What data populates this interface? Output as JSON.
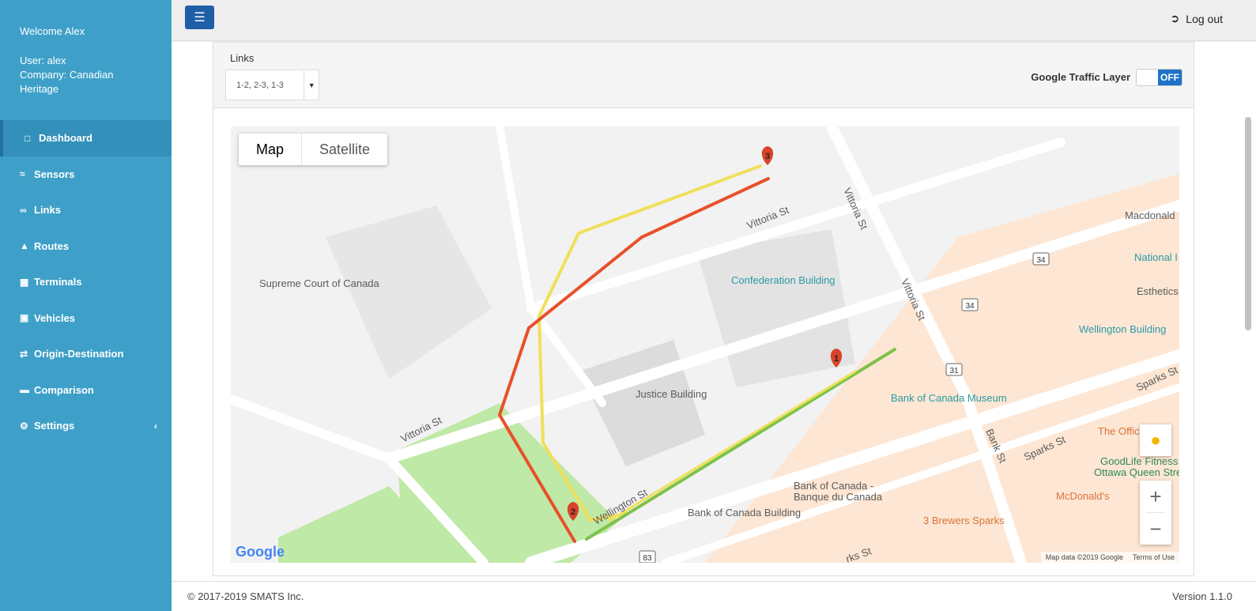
{
  "sidebar": {
    "welcome": "Welcome Alex",
    "user": "User: alex",
    "company": "Company: Canadian Heritage",
    "items": [
      {
        "label": "Dashboard",
        "icon": "map-icon"
      },
      {
        "label": "Sensors",
        "icon": "wifi-icon"
      },
      {
        "label": "Links",
        "icon": "link-icon"
      },
      {
        "label": "Routes",
        "icon": "road-icon"
      },
      {
        "label": "Terminals",
        "icon": "grid-icon"
      },
      {
        "label": "Vehicles",
        "icon": "bus-icon"
      },
      {
        "label": "Origin-Destination",
        "icon": "shuffle-icon"
      },
      {
        "label": "Comparison",
        "icon": "hdd-icon"
      },
      {
        "label": "Settings",
        "icon": "gear-icon"
      }
    ]
  },
  "header": {
    "logout": "Log out"
  },
  "filters": {
    "links_label": "Links",
    "links_value": "1-2, 2-3, 1-3",
    "traffic_label": "Google Traffic Layer",
    "traffic_state": "OFF"
  },
  "map": {
    "type_map": "Map",
    "type_satellite": "Satellite",
    "markers": [
      "1",
      "2",
      "3"
    ],
    "labels": {
      "supreme_court": "Supreme Court of Canada",
      "confederation": "Confederation Building",
      "justice": "Justice Building",
      "bank_museum": "Bank of Canada Museum",
      "bank_canada": "Bank of Canada -",
      "bank_canada2": "Banque du Canada",
      "bank_building": "Bank of Canada Building",
      "wellington_building": "Wellington Building",
      "brewers": "3 Brewers Sparks",
      "goodlife": "GoodLife Fitness",
      "goodlife2": "Ottawa Queen Stree",
      "mcdonalds": "McDonald's",
      "macdonald": "Macdonald",
      "national": "National I",
      "esthetics": "Esthetics",
      "office": "The Offic",
      "vittoria1": "Vittoria St",
      "vittoria2": "Vittoria St",
      "vittoria3": "Vittoria St",
      "vittoria4": "Vittoria St",
      "wellington": "Wellington St",
      "bank_st": "Bank St",
      "sparks1": "Sparks St",
      "sparks2": "Sparks St",
      "sparks3": "rks St",
      "hw34a": "34",
      "hw34b": "34",
      "hw31": "31",
      "hw83": "83"
    },
    "google": "Google",
    "map_data": "Map data ©2019 Google",
    "terms": "Terms of Use",
    "route_colors": {
      "red": "#e8502a",
      "yellow": "#f0e05a",
      "green": "#7dc24a"
    }
  },
  "footer": {
    "copyright": "© 2017-2019 SMATS Inc.",
    "version": "Version 1.1.0"
  }
}
